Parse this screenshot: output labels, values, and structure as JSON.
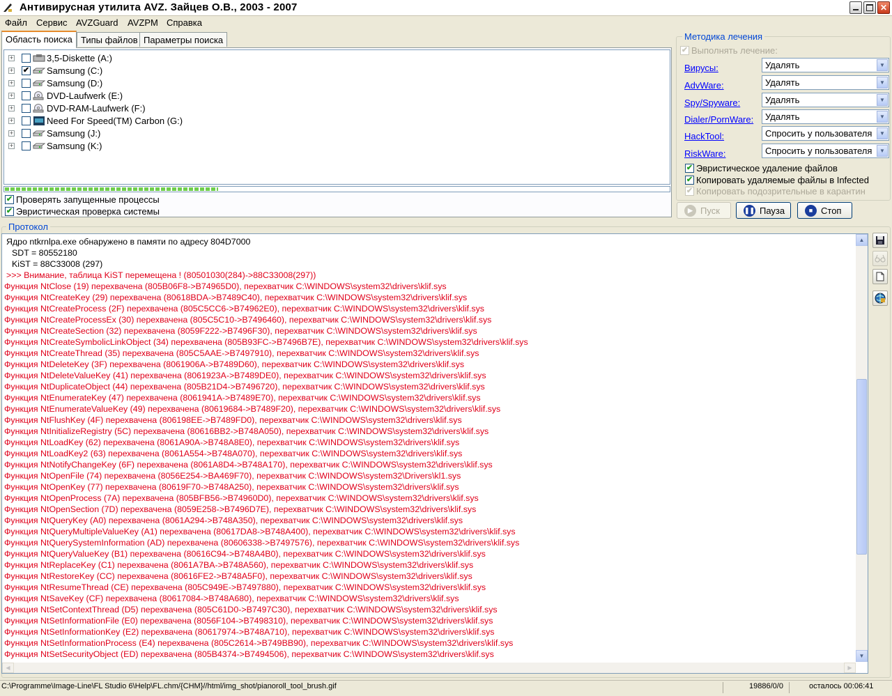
{
  "window": {
    "title": "Антивирусная утилита AVZ. Зайцев О.В., 2003 - 2007",
    "controls": [
      "minimize",
      "maximize",
      "close"
    ]
  },
  "menu": [
    "Файл",
    "Сервис",
    "AVZGuard",
    "AVZPM",
    "Справка"
  ],
  "tabs": [
    "Область поиска",
    "Типы файлов",
    "Параметры поиска"
  ],
  "drives": [
    {
      "label": "3,5-Diskette (A:)",
      "checked": false,
      "icon": "floppy-drive-icon"
    },
    {
      "label": "Samsung (C:)",
      "checked": true,
      "icon": "hard-drive-icon"
    },
    {
      "label": "Samsung (D:)",
      "checked": false,
      "icon": "hard-drive-icon"
    },
    {
      "label": "DVD-Laufwerk (E:)",
      "checked": false,
      "icon": "cd-drive-icon"
    },
    {
      "label": "DVD-RAM-Laufwerk (F:)",
      "checked": false,
      "icon": "cd-drive-icon"
    },
    {
      "label": "Need For Speed(TM) Carbon (G:)",
      "checked": false,
      "icon": "game-disc-icon"
    },
    {
      "label": "Samsung (J:)",
      "checked": false,
      "icon": "hard-drive-icon"
    },
    {
      "label": "Samsung (K:)",
      "checked": false,
      "icon": "hard-drive-icon"
    }
  ],
  "progress": {
    "fraction": 0.32
  },
  "search_options": {
    "check_processes": "Проверять запущенные процессы",
    "heuristic_check": "Эвристическая проверка системы"
  },
  "treatment": {
    "title": "Методика лечения",
    "perform_treatment": "Выполнять лечение:",
    "rows": [
      {
        "link": "Вирусы:",
        "value": "Удалять"
      },
      {
        "link": "AdvWare:",
        "value": "Удалять"
      },
      {
        "link": "Spy/Spyware:",
        "value": "Удалять"
      },
      {
        "link": "Dialer/PornWare:",
        "value": "Удалять"
      },
      {
        "link": "HackTool:",
        "value": "Спросить у пользователя"
      },
      {
        "link": "RiskWare:",
        "value": "Спросить у пользователя"
      }
    ],
    "heuristic_delete": "Эвристическое удаление файлов",
    "copy_deleted": "Копировать удаляемые файлы в  Infected",
    "copy_suspicious": "Копировать подозрительные в  карантин"
  },
  "buttons": {
    "start": "Пуск",
    "pause": "Пауза",
    "stop": "Стоп"
  },
  "protocol": {
    "title": "Протокол",
    "lines": [
      {
        "text": "Ядро ntkrnlpa.exe обнаружено в памяти по адресу 804D7000",
        "color": "black",
        "indent": true
      },
      {
        "text": "SDT = 80552180",
        "color": "black",
        "indent": true
      },
      {
        "text": "KiST = 88C33008 (297)",
        "color": "black",
        "indent": true
      },
      {
        "text": ">>> Внимание, таблица KiST перемещена ! (80501030(284)->88C33008(297))",
        "color": "red",
        "indent": true
      },
      {
        "text": "Функция NtClose (19) перехвачена (805B06F8->B74965D0), перехватчик C:\\WINDOWS\\system32\\drivers\\klif.sys",
        "color": "red"
      },
      {
        "text": "Функция NtCreateKey (29) перехвачена (80618BDA->B7489C40), перехватчик C:\\WINDOWS\\system32\\drivers\\klif.sys",
        "color": "red"
      },
      {
        "text": "Функция NtCreateProcess (2F) перехвачена (805C5CC6->B74962E0), перехватчик C:\\WINDOWS\\system32\\drivers\\klif.sys",
        "color": "red"
      },
      {
        "text": "Функция NtCreateProcessEx (30) перехвачена (805C5C10->B7496460), перехватчик C:\\WINDOWS\\system32\\drivers\\klif.sys",
        "color": "red"
      },
      {
        "text": "Функция NtCreateSection (32) перехвачена (8059F222->B7496F30), перехватчик C:\\WINDOWS\\system32\\drivers\\klif.sys",
        "color": "red"
      },
      {
        "text": "Функция NtCreateSymbolicLinkObject (34) перехвачена (805B93FC->B7496B7E), перехватчик C:\\WINDOWS\\system32\\drivers\\klif.sys",
        "color": "red"
      },
      {
        "text": "Функция NtCreateThread (35) перехвачена (805C5AAE->B7497910), перехватчик C:\\WINDOWS\\system32\\drivers\\klif.sys",
        "color": "red"
      },
      {
        "text": "Функция NtDeleteKey (3F) перехвачена (8061906A->B7489D60), перехватчик C:\\WINDOWS\\system32\\drivers\\klif.sys",
        "color": "red"
      },
      {
        "text": "Функция NtDeleteValueKey (41) перехвачена (8061923A->B7489DE0), перехватчик C:\\WINDOWS\\system32\\drivers\\klif.sys",
        "color": "red"
      },
      {
        "text": "Функция NtDuplicateObject (44) перехвачена (805B21D4->B7496720), перехватчик C:\\WINDOWS\\system32\\drivers\\klif.sys",
        "color": "red"
      },
      {
        "text": "Функция NtEnumerateKey (47) перехвачена (8061941A->B7489E70), перехватчик C:\\WINDOWS\\system32\\drivers\\klif.sys",
        "color": "red"
      },
      {
        "text": "Функция NtEnumerateValueKey (49) перехвачена (80619684->B7489F20), перехватчик C:\\WINDOWS\\system32\\drivers\\klif.sys",
        "color": "red"
      },
      {
        "text": "Функция NtFlushKey (4F) перехвачена (806198EE->B7489FD0), перехватчик C:\\WINDOWS\\system32\\drivers\\klif.sys",
        "color": "red"
      },
      {
        "text": "Функция NtInitializeRegistry (5C) перехвачена (80616BB2->B748A050), перехватчик C:\\WINDOWS\\system32\\drivers\\klif.sys",
        "color": "red"
      },
      {
        "text": "Функция NtLoadKey (62) перехвачена (8061A90A->B748A8E0), перехватчик C:\\WINDOWS\\system32\\drivers\\klif.sys",
        "color": "red"
      },
      {
        "text": "Функция NtLoadKey2 (63) перехвачена (8061A554->B748A070), перехватчик C:\\WINDOWS\\system32\\drivers\\klif.sys",
        "color": "red"
      },
      {
        "text": "Функция NtNotifyChangeKey (6F) перехвачена (8061A8D4->B748A170), перехватчик C:\\WINDOWS\\system32\\drivers\\klif.sys",
        "color": "red"
      },
      {
        "text": "Функция NtOpenFile (74) перехвачена (8056E254->BA469F70), перехватчик C:\\WINDOWS\\system32\\Drivers\\kl1.sys",
        "color": "red"
      },
      {
        "text": "Функция NtOpenKey (77) перехвачена (80619F70->B748A250), перехватчик C:\\WINDOWS\\system32\\drivers\\klif.sys",
        "color": "red"
      },
      {
        "text": "Функция NtOpenProcess (7A) перехвачена (805BFB56->B74960D0), перехватчик C:\\WINDOWS\\system32\\drivers\\klif.sys",
        "color": "red"
      },
      {
        "text": "Функция NtOpenSection (7D) перехвачена (8059E258->B7496D7E), перехватчик C:\\WINDOWS\\system32\\drivers\\klif.sys",
        "color": "red"
      },
      {
        "text": "Функция NtQueryKey (A0) перехвачена (8061A294->B748A350), перехватчик C:\\WINDOWS\\system32\\drivers\\klif.sys",
        "color": "red"
      },
      {
        "text": "Функция NtQueryMultipleValueKey (A1) перехвачена (80617DA8->B748A400), перехватчик C:\\WINDOWS\\system32\\drivers\\klif.sys",
        "color": "red"
      },
      {
        "text": "Функция NtQuerySystemInformation (AD) перехвачена (80606338->B7497576), перехватчик C:\\WINDOWS\\system32\\drivers\\klif.sys",
        "color": "red"
      },
      {
        "text": "Функция NtQueryValueKey (B1) перехвачена (80616C94->B748A4B0), перехватчик C:\\WINDOWS\\system32\\drivers\\klif.sys",
        "color": "red"
      },
      {
        "text": "Функция NtReplaceKey (C1) перехвачена (8061A7BA->B748A560), перехватчик C:\\WINDOWS\\system32\\drivers\\klif.sys",
        "color": "red"
      },
      {
        "text": "Функция NtRestoreKey (CC) перехвачена (80616FE2->B748A5F0), перехватчик C:\\WINDOWS\\system32\\drivers\\klif.sys",
        "color": "red"
      },
      {
        "text": "Функция NtResumeThread (CE) перехвачена (805C949E->B7497880), перехватчик C:\\WINDOWS\\system32\\drivers\\klif.sys",
        "color": "red"
      },
      {
        "text": "Функция NtSaveKey (CF) перехвачена (80617084->B748A680), перехватчик C:\\WINDOWS\\system32\\drivers\\klif.sys",
        "color": "red"
      },
      {
        "text": "Функция NtSetContextThread (D5) перехвачена (805C61D0->B7497C30), перехватчик C:\\WINDOWS\\system32\\drivers\\klif.sys",
        "color": "red"
      },
      {
        "text": "Функция NtSetInformationFile (E0) перехвачена (8056F104->B7498310), перехватчик C:\\WINDOWS\\system32\\drivers\\klif.sys",
        "color": "red"
      },
      {
        "text": "Функция NtSetInformationKey (E2) перехвачена (80617974->B748A710), перехватчик C:\\WINDOWS\\system32\\drivers\\klif.sys",
        "color": "red"
      },
      {
        "text": "Функция NtSetInformationProcess (E4) перехвачена (805C2614->B749BB90), перехватчик C:\\WINDOWS\\system32\\drivers\\klif.sys",
        "color": "red"
      },
      {
        "text": "Функция NtSetSecurityObject (ED) перехвачена (805B4374->B7494506), перехватчик C:\\WINDOWS\\system32\\drivers\\klif.sys",
        "color": "red"
      }
    ]
  },
  "side_tools": [
    "save-log-icon",
    "glasses-icon",
    "document-icon",
    "network-icon"
  ],
  "status": {
    "path": "C:\\Programme\\Image-Line\\FL Studio 6\\Help\\FL.chm/{CHM}//html/img_shot/pianoroll_tool_brush.gif",
    "counts": "19886/0/0",
    "remaining": "осталось 00:06:41"
  }
}
